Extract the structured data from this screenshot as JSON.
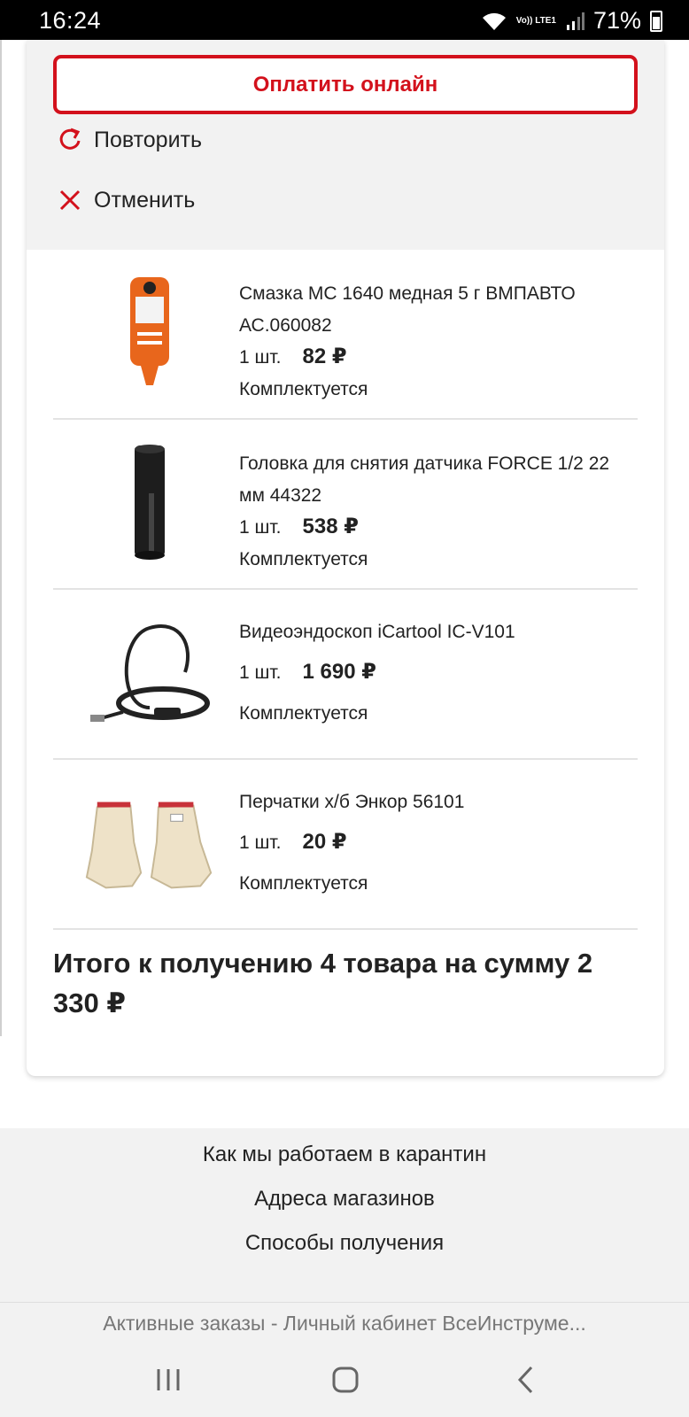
{
  "status_bar": {
    "time": "16:24",
    "network_label": "Vo)) LTE1",
    "battery": "71%",
    "icons": [
      "wifi-icon",
      "signal-icon",
      "battery-icon"
    ]
  },
  "order": {
    "pay_online_label": "Оплатить онлайн",
    "repeat_label": "Повторить",
    "cancel_label": "Отменить",
    "items": [
      {
        "name": "Смазка МС 1640 медная 5 г ВМПАВТО АС.060082",
        "qty": "1 шт.",
        "price": "82 ₽",
        "status": "Комплектуется",
        "image": "copper-grease-tube"
      },
      {
        "name": "Головка для снятия датчика FORCE 1/2 22 мм 44322",
        "qty": "1 шт.",
        "price": "538 ₽",
        "status": "Комплектуется",
        "image": "sensor-socket"
      },
      {
        "name": "Видеоэндоскоп iCartool IC-V101",
        "qty": "1 шт.",
        "price": "1 690 ₽",
        "status": "Комплектуется",
        "image": "video-endoscope"
      },
      {
        "name": "Перчатки х/б Энкор 56101",
        "qty": "1 шт.",
        "price": "20 ₽",
        "status": "Комплектуется",
        "image": "cotton-gloves"
      }
    ],
    "total_text": "Итого к получению 4 товара на сумму 2 330 ₽"
  },
  "footer": {
    "links": [
      "Как мы работаем в карантин",
      "Адреса магазинов",
      "Способы получения"
    ]
  },
  "browser": {
    "page_title": "Активные заказы - Личный кабинет ВсеИнструме..."
  },
  "colors": {
    "accent": "#d3111c",
    "panel": "#f2f2f2",
    "text": "#222222"
  }
}
